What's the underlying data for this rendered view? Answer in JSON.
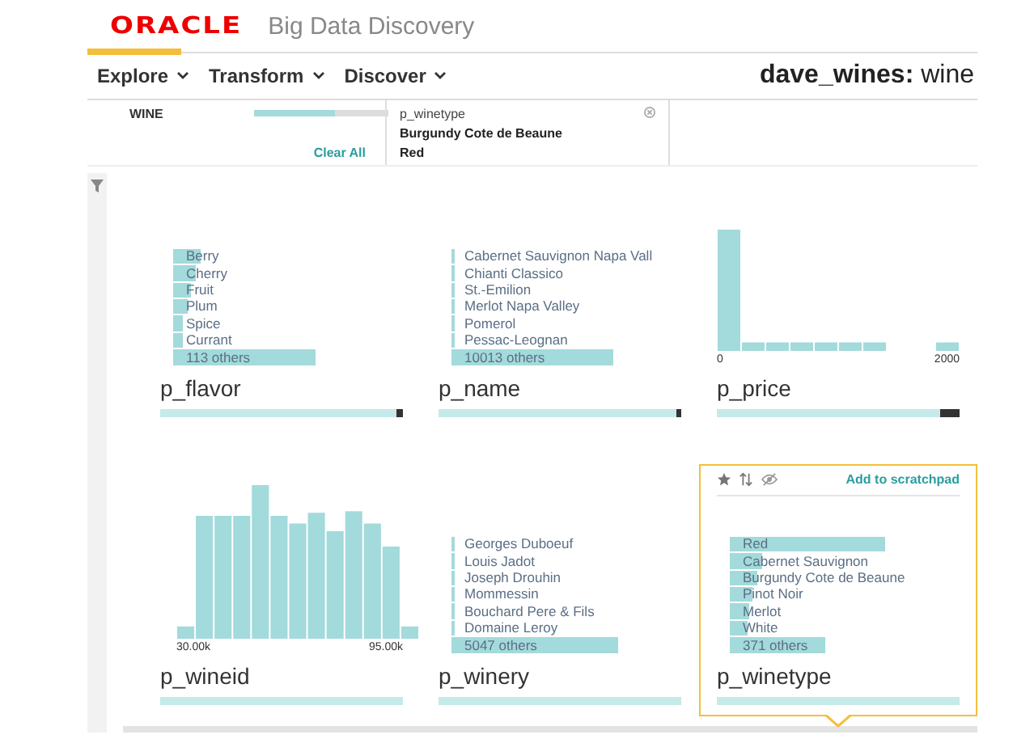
{
  "header": {
    "logo": "ORACLE",
    "product": "Big Data Discovery"
  },
  "nav": [
    {
      "label": "Explore",
      "selected": true
    },
    {
      "label": "Transform",
      "selected": false
    },
    {
      "label": "Discover",
      "selected": false
    }
  ],
  "project": {
    "name": "dave_wines:",
    "dataset": "wine"
  },
  "filter_bar": {
    "dataset": "WINE",
    "level": 0.6,
    "clear": "Clear All",
    "refinements": [
      {
        "attribute": "p_winetype",
        "values": [
          "Burgundy Cote de Beaune",
          "Red"
        ]
      }
    ]
  },
  "cards": [
    {
      "title": "p_flavor",
      "kind": "bars",
      "level": 0.97,
      "selected": false,
      "items": [
        {
          "label": "Berry",
          "level": 0.11
        },
        {
          "label": "Cherry",
          "level": 0.09
        },
        {
          "label": "Fruit",
          "level": 0.07
        },
        {
          "label": "Plum",
          "level": 0.06
        },
        {
          "label": "Spice",
          "level": 0.04
        },
        {
          "label": "Currant",
          "level": 0.04
        },
        {
          "label": "113 others",
          "level": 0.58
        }
      ]
    },
    {
      "title": "p_name",
      "kind": "bars",
      "level": 0.98,
      "selected": false,
      "items": [
        {
          "label": "Cabernet Sauvignon Napa Vall",
          "level": 0.01
        },
        {
          "label": "Chianti Classico",
          "level": 0.01
        },
        {
          "label": "St.-Emilion",
          "level": 0.01
        },
        {
          "label": "Merlot Napa Valley",
          "level": 0.01
        },
        {
          "label": "Pomerol",
          "level": 0.01
        },
        {
          "label": "Pessac-Leognan",
          "level": 0.01
        },
        {
          "label": "10013 others",
          "level": 0.66
        }
      ]
    },
    {
      "title": "p_price",
      "kind": "histogram",
      "level": 0.92,
      "selected": false,
      "axis": [
        "0",
        "2000"
      ]
    },
    {
      "title": "p_wineid",
      "kind": "histogram",
      "level": 1,
      "selected": false,
      "axis": [
        "30.00k",
        "95.00k"
      ]
    },
    {
      "title": "p_winery",
      "kind": "bars",
      "level": 1,
      "selected": false,
      "items": [
        {
          "label": "Georges Duboeuf",
          "level": 0.01
        },
        {
          "label": "Louis Jadot",
          "level": 0.01
        },
        {
          "label": "Joseph Drouhin",
          "level": 0.01
        },
        {
          "label": "Mommessin",
          "level": 0.01
        },
        {
          "label": "Bouchard Pere & Fils",
          "level": 0.01
        },
        {
          "label": "Domaine Leroy",
          "level": 0.01
        },
        {
          "label": "5047 others",
          "level": 0.68
        }
      ]
    },
    {
      "title": "p_winetype",
      "kind": "bars",
      "level": 1,
      "selected": true,
      "action": "Add to scratchpad",
      "items": [
        {
          "label": "Red",
          "level": 0.63
        },
        {
          "label": "Cabernet Sauvignon",
          "level": 0.13
        },
        {
          "label": "Burgundy Cote de Beaune",
          "level": 0.11
        },
        {
          "label": "Pinot Noir",
          "level": 0.09
        },
        {
          "label": "Merlot",
          "level": 0.08
        },
        {
          "label": "White",
          "level": 0.07
        },
        {
          "label": "371 others",
          "level": 0.39
        }
      ]
    }
  ]
}
